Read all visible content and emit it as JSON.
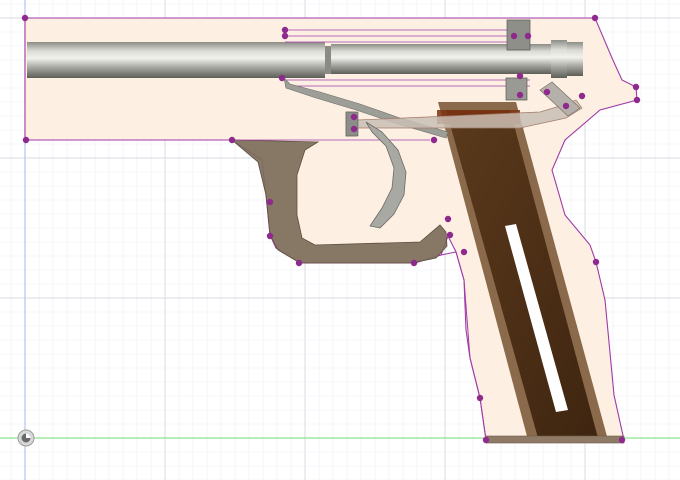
{
  "viewport": {
    "background": "#ffffff",
    "grid_major_color": "#d7dbe1",
    "grid_minor_color": "#eef0f3",
    "axis_y_color": "#b9c3f0",
    "axis_x_color": "#8fe28f"
  },
  "sketch": {
    "profile_color": "#a03aa8",
    "point_color": "#8e2a8e",
    "fill_color": "#fdf0e3",
    "barrel_dark": "#6b6b66",
    "barrel_light": "#e2e2dc",
    "trigger_guard_color": "#7d6c5a",
    "grip_panel_color": "#4e2f16",
    "grip_border_color": "#8a6a4a",
    "slot_color": "#ffffff",
    "hammer_color": "#c9beb4",
    "origin_icon": "origin-marker-icon"
  }
}
